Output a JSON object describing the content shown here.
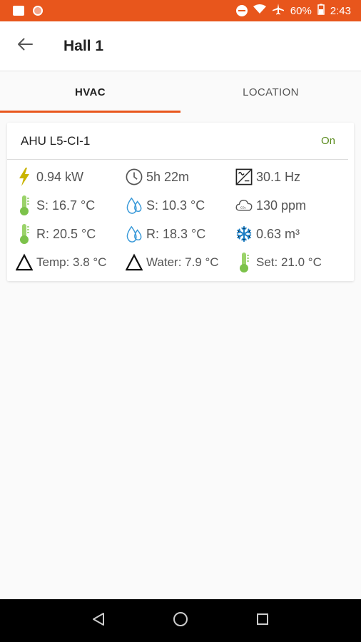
{
  "status_bar": {
    "battery": "60%",
    "time": "2:43",
    "background_color": "#e8561c"
  },
  "app_bar": {
    "title": "Hall 1",
    "back_icon": "arrow-left-icon"
  },
  "tabs": [
    {
      "label": "HVAC",
      "active": true
    },
    {
      "label": "LOCATION",
      "active": false
    }
  ],
  "accent_color": "#e8561c",
  "unit": {
    "name": "AHU L5-CI-1",
    "status": "On",
    "status_color": "#5b8c1e",
    "metrics": [
      {
        "icon": "lightning-bolt-icon",
        "value": "0.94 kW"
      },
      {
        "icon": "clock-icon",
        "value": "5h 22m"
      },
      {
        "icon": "inverter-frequency-icon",
        "value": "30.1 Hz"
      },
      {
        "icon": "thermometer-icon",
        "value": "S: 16.7 °C"
      },
      {
        "icon": "water-drop-icon",
        "value": "S: 10.3 °C"
      },
      {
        "icon": "co2-cloud-icon",
        "value": "130 ppm"
      },
      {
        "icon": "thermometer-icon",
        "value": "R: 20.5 °C"
      },
      {
        "icon": "water-drop-icon",
        "value": "R: 18.3 °C"
      },
      {
        "icon": "snowflake-icon",
        "value": "0.63 m³"
      },
      {
        "icon": "delta-icon",
        "value": "Temp: 3.8 °C"
      },
      {
        "icon": "delta-icon",
        "value": "Water: 7.9 °C"
      },
      {
        "icon": "thermometer-icon",
        "value": "Set: 21.0 °C"
      }
    ]
  },
  "nav_bar": {
    "buttons": [
      "back-triangle-icon",
      "home-circle-icon",
      "recents-square-icon"
    ]
  }
}
